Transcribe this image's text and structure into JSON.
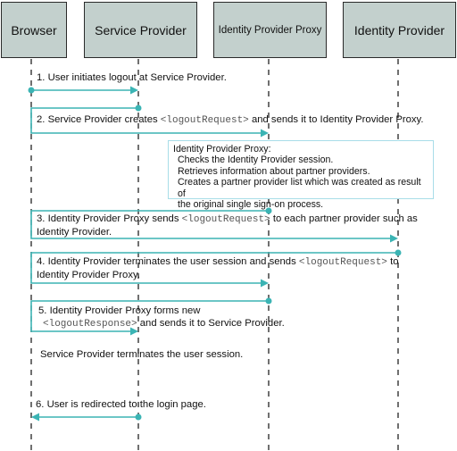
{
  "diagram": {
    "type": "sequence",
    "accent_color": "#3bb4b4",
    "actors": [
      {
        "id": "browser",
        "label": "Browser"
      },
      {
        "id": "sp",
        "label": "Service Provider"
      },
      {
        "id": "idpp",
        "label": "Identity Provider Proxy"
      },
      {
        "id": "idp",
        "label": "Identity Provider"
      }
    ],
    "steps": [
      {
        "num": "1.",
        "text": "User initiates logout at Service Provider.",
        "from": "browser",
        "to": "sp"
      },
      {
        "num": "2.",
        "text_before": "Service Provider creates",
        "code": "<logoutRequest>",
        "text_after": "and sends it to Identity Provider Proxy.",
        "from": "sp",
        "to": "idpp"
      },
      {
        "num": "3.",
        "text_before": "Identity Provider Proxy sends",
        "code": "<logoutRequest>",
        "text_after": "to each partner provider such as",
        "text_line2": "Identity Provider.",
        "from": "idpp",
        "to": "idp"
      },
      {
        "num": "4.",
        "text_before": "Identity Provider terminates the user session and sends",
        "code": "<logoutRequest>",
        "text_after": "to",
        "text_line2": "Identity Provider Proxy.",
        "from": "idp",
        "to": "idpp"
      },
      {
        "num": "5.",
        "text_before": "Identity Provider Proxy forms new",
        "code": "<logoutResponse>",
        "text_after": "and sends it to Service Provider.",
        "from": "idpp",
        "to": "sp"
      },
      {
        "num": "6.",
        "text": "User is redirected to the login page.",
        "from": "sp",
        "to": "browser"
      }
    ],
    "note": {
      "title": "Identity Provider Proxy:",
      "lines": [
        "Checks the Identity Provider session.",
        "Retrieves information about partner providers.",
        "Creates a partner provider list which was created as result of",
        "the original single sign-on process."
      ]
    },
    "sp_note": "Service Provider terminates the user session."
  }
}
